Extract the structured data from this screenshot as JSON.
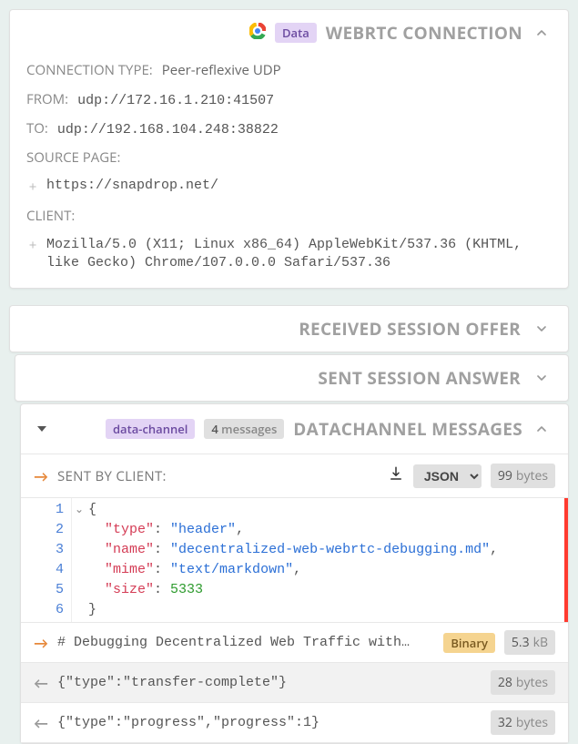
{
  "connection": {
    "badge": "Data",
    "title": "WEBRTC CONNECTION",
    "type_label": "CONNECTION TYPE:",
    "type_value": "Peer-reflexive UDP",
    "from_label": "FROM:",
    "from_value": "udp://172.16.1.210:41507",
    "to_label": "TO:",
    "to_value": "udp://192.168.104.248:38822",
    "source_label": "SOURCE PAGE:",
    "source_value": "https://snapdrop.net/",
    "client_label": "CLIENT:",
    "client_value": "Mozilla/5.0 (X11; Linux x86_64) AppleWebKit/537.36 (KHTML, like Gecko) Chrome/107.0.0.0 Safari/537.36"
  },
  "sections": {
    "offer": "RECEIVED SESSION OFFER",
    "answer": "SENT SESSION ANSWER",
    "datachannel": {
      "badge": "data-channel",
      "messages_count": "4",
      "messages_word": "messages",
      "title": "DATACHANNEL MESSAGES"
    }
  },
  "sent_bar": {
    "label": "SENT BY CLIENT:",
    "format": "JSON",
    "size_num": "99",
    "size_unit": "bytes"
  },
  "json_payload": {
    "lines": [
      "1",
      "2",
      "3",
      "4",
      "5",
      "6"
    ],
    "l1": "{",
    "k_type": "\"type\"",
    "v_type": "\"header\"",
    "k_name": "\"name\"",
    "v_name": "\"decentralized-web-webrtc-debugging.md\"",
    "k_mime": "\"mime\"",
    "v_mime": "\"text/markdown\"",
    "k_size": "\"size\"",
    "v_size": "5333",
    "l6": "}"
  },
  "rows": {
    "binary": {
      "content": "# Debugging Decentralized Web Traffic with…",
      "badge": "Binary",
      "size_num": "5.3",
      "size_unit": "kB"
    },
    "r1": {
      "content": "{\"type\":\"transfer-complete\"}",
      "size_num": "28",
      "size_unit": "bytes"
    },
    "r2": {
      "content": "{\"type\":\"progress\",\"progress\":1}",
      "size_num": "32",
      "size_unit": "bytes"
    }
  }
}
